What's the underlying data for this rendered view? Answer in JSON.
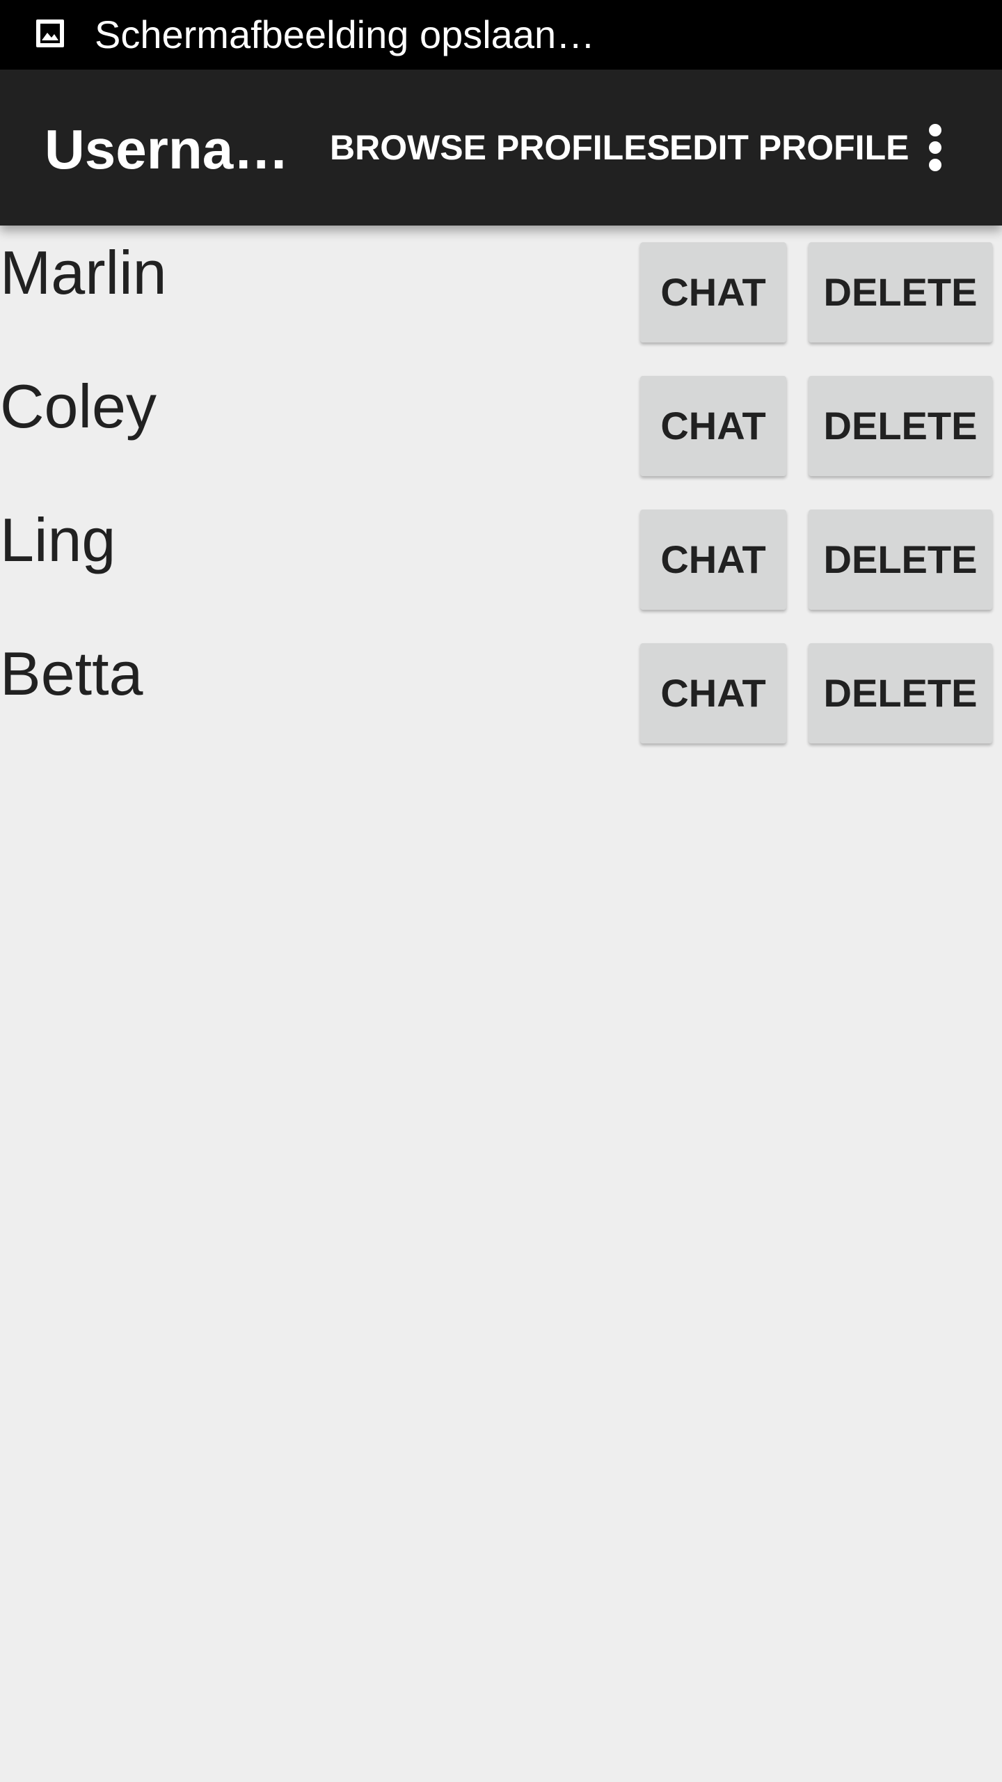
{
  "status_bar": {
    "icon": "image-icon",
    "text": "Schermafbeelding opslaan…"
  },
  "app_bar": {
    "title": "Userna…",
    "actions": [
      {
        "label": "BROWSE PROFILES"
      },
      {
        "label": "EDIT PROFILE"
      }
    ],
    "overflow_icon": "more-vert-icon"
  },
  "contacts": [
    {
      "name": "Marlin",
      "chat_label": "CHAT",
      "delete_label": "DELETE"
    },
    {
      "name": "Coley",
      "chat_label": "CHAT",
      "delete_label": "DELETE"
    },
    {
      "name": "Ling",
      "chat_label": "CHAT",
      "delete_label": "DELETE"
    },
    {
      "name": "Betta",
      "chat_label": "CHAT",
      "delete_label": "DELETE"
    }
  ],
  "colors": {
    "status_bar_bg": "#000000",
    "app_bar_bg": "#212121",
    "page_bg": "#eeeeee",
    "button_bg": "#d6d7d7",
    "text": "#212121"
  }
}
